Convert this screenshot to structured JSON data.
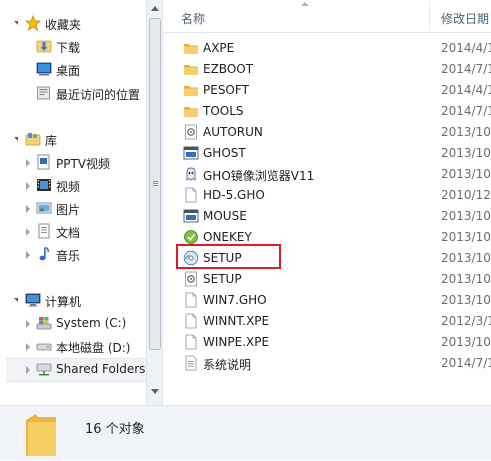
{
  "nav": {
    "favorites": {
      "label": "收藏夹",
      "icon": "star-icon"
    },
    "favorites_items": [
      {
        "label": "下载",
        "icon": "downloads-folder-icon"
      },
      {
        "label": "桌面",
        "icon": "desktop-icon"
      },
      {
        "label": "最近访问的位置",
        "icon": "recent-places-icon"
      }
    ],
    "libraries": {
      "label": "库",
      "icon": "library-icon"
    },
    "library_items": [
      {
        "label": "PPTV视频",
        "icon": "video-library-icon"
      },
      {
        "label": "视频",
        "icon": "film-icon"
      },
      {
        "label": "图片",
        "icon": "pictures-icon"
      },
      {
        "label": "文档",
        "icon": "documents-icon"
      },
      {
        "label": "音乐",
        "icon": "music-note-icon"
      }
    ],
    "computer": {
      "label": "计算机",
      "icon": "computer-icon"
    },
    "computer_items": [
      {
        "label": "System (C:)",
        "icon": "system-drive-icon"
      },
      {
        "label": "本地磁盘 (D:)",
        "icon": "hard-drive-icon"
      },
      {
        "label": "Shared Folders",
        "icon": "network-share-icon"
      }
    ]
  },
  "columns": {
    "name": "名称",
    "date": "修改日期"
  },
  "files": [
    {
      "name": "AXPE",
      "date": "2014/4/1",
      "icon": "folder-icon"
    },
    {
      "name": "EZBOOT",
      "date": "2014/7/1",
      "icon": "folder-icon"
    },
    {
      "name": "PESOFT",
      "date": "2014/4/1",
      "icon": "folder-icon"
    },
    {
      "name": "TOOLS",
      "date": "2014/7/1",
      "icon": "folder-icon"
    },
    {
      "name": "AUTORUN",
      "date": "2013/10/",
      "icon": "settings-file-icon"
    },
    {
      "name": "GHOST",
      "date": "2013/10/",
      "icon": "app-window-icon"
    },
    {
      "name": "GHO镜像浏览器V11",
      "date": "2013/10/",
      "icon": "ghost-explorer-icon"
    },
    {
      "name": "HD-5.GHO",
      "date": "2010/12/",
      "icon": "file-icon"
    },
    {
      "name": "MOUSE",
      "date": "2013/10/",
      "icon": "app-window-icon"
    },
    {
      "name": "ONEKEY",
      "date": "2013/10/",
      "icon": "onekey-app-icon"
    },
    {
      "name": "SETUP",
      "date": "2013/10/",
      "icon": "setup-disc-icon"
    },
    {
      "name": "SETUP",
      "date": "2013/10/",
      "icon": "settings-file-icon"
    },
    {
      "name": "WIN7.GHO",
      "date": "2013/10/",
      "icon": "file-icon"
    },
    {
      "name": "WINNT.XPE",
      "date": "2012/3/1",
      "icon": "file-icon"
    },
    {
      "name": "WINPE.XPE",
      "date": "2013/10/",
      "icon": "file-icon"
    },
    {
      "name": "系统说明",
      "date": "2014/7/1",
      "icon": "text-document-icon"
    }
  ],
  "status": {
    "count": "16 个对象",
    "icon": "folder-large-icon"
  },
  "colors": {
    "highlight": "#e11b22",
    "accent": "#4c607a"
  }
}
